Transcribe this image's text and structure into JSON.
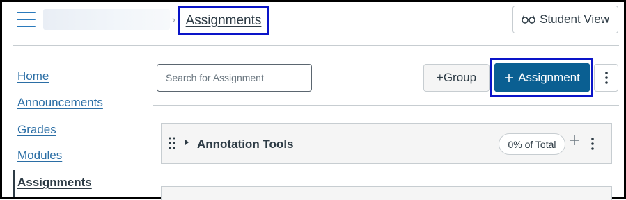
{
  "header": {
    "breadcrumb_separator": "›",
    "breadcrumb_current": "Assignments",
    "student_view_label": "Student View"
  },
  "sidebar": {
    "items": [
      {
        "label": "Home"
      },
      {
        "label": "Announcements"
      },
      {
        "label": "Grades"
      },
      {
        "label": "Modules"
      },
      {
        "label": "Assignments",
        "active": true
      }
    ]
  },
  "toolbar": {
    "search_placeholder": "Search for Assignment",
    "group_button_label": "+Group",
    "assignment_button_label": "Assignment"
  },
  "assignment_groups": [
    {
      "title": "Annotation Tools",
      "weight_label": "0% of Total"
    }
  ],
  "colors": {
    "link": "#2b6ea5",
    "primary_button": "#0a5f92",
    "highlight_outline": "#0a14c8"
  },
  "icons": {
    "menu": "hamburger-icon",
    "student_view": "glasses-icon",
    "kebab": "kebab-icon",
    "drag": "drag-handle-icon",
    "expand": "caret-right-icon",
    "add": "plus-icon"
  }
}
